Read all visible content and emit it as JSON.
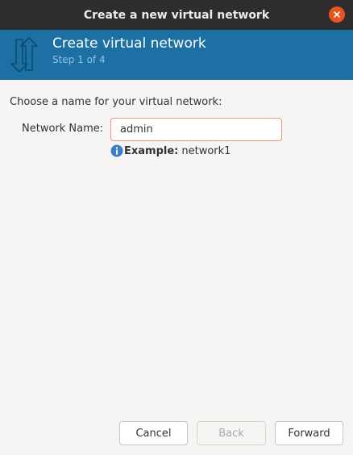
{
  "window": {
    "title": "Create a new virtual network",
    "close_icon": "close-icon"
  },
  "header": {
    "title": "Create virtual network",
    "subtitle": "Step 1 of 4",
    "icon": "network-arrows-icon"
  },
  "form": {
    "prompt": "Choose a name for your virtual network:",
    "network_name_label": "Network Name:",
    "network_name_value": "admin",
    "example_label": "Example:",
    "example_value": "network1",
    "info_icon": "info-icon"
  },
  "buttons": {
    "cancel": "Cancel",
    "back": "Back",
    "back_enabled": false,
    "forward": "Forward"
  },
  "colors": {
    "titlebar": "#2d2d2d",
    "banner": "#1d70a3",
    "subtitle": "#8dc3e6",
    "close": "#e95420",
    "input_border": "#e4997d",
    "info": "#3d7dc5"
  }
}
